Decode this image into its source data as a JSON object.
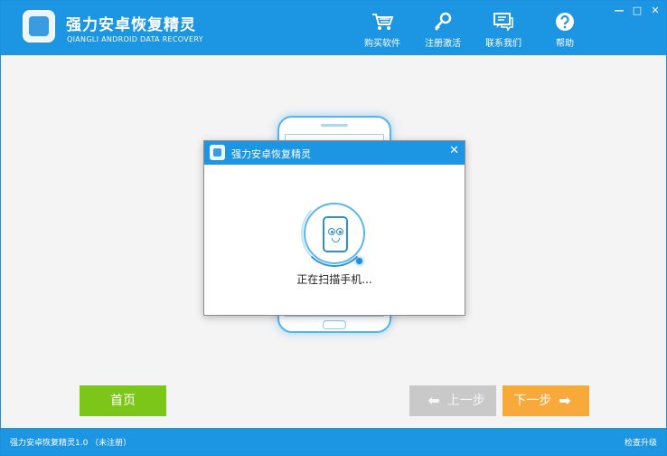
{
  "app": {
    "title": "强力安卓恢复精灵",
    "subtitle": "QIANGLI ANDROID DATA RECOVERY"
  },
  "nav": [
    {
      "label": "购买软件",
      "icon": "cart-icon"
    },
    {
      "label": "注册激活",
      "icon": "key-icon"
    },
    {
      "label": "联系我们",
      "icon": "chat-icon"
    },
    {
      "label": "帮助",
      "icon": "help-icon"
    }
  ],
  "window_controls": {
    "minimize": "—",
    "maximize": "□",
    "close": "✕"
  },
  "dialog": {
    "title": "强力安卓恢复精灵",
    "close": "✕",
    "message": "正在扫描手机..."
  },
  "buttons": {
    "home": "首页",
    "prev": "上一步",
    "next": "下一步"
  },
  "status": {
    "left": "强力安卓恢复精灵1.0 （未注册）",
    "right": "检查升级"
  },
  "colors": {
    "primary": "#1c95e3",
    "home_button": "#7cc61a",
    "next_button": "#f7aa3a",
    "prev_button_disabled": "#c9c9c9"
  }
}
